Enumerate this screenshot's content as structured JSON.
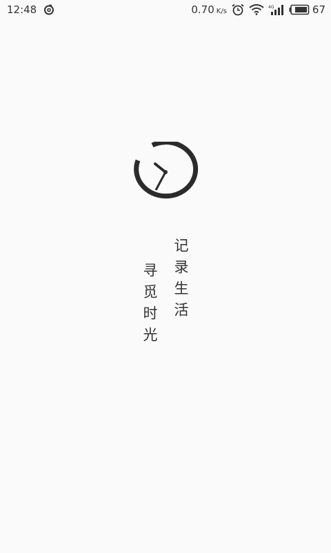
{
  "status_bar": {
    "time": "12:48",
    "speed_value": "0.70",
    "speed_unit": "K/s",
    "network_type": "4G",
    "battery_level": "67"
  },
  "splash": {
    "slogan_right": "记录生活",
    "slogan_left": "寻觅时光"
  },
  "icons": {
    "app_notification": "netease-music-icon",
    "alarm": "alarm-clock-icon",
    "wifi": "wifi-icon",
    "cellular": "cellular-signal-icon",
    "battery": "battery-icon",
    "logo": "clock-logo-icon"
  },
  "colors": {
    "background": "#fafafa",
    "foreground": "#2b2b2b"
  }
}
